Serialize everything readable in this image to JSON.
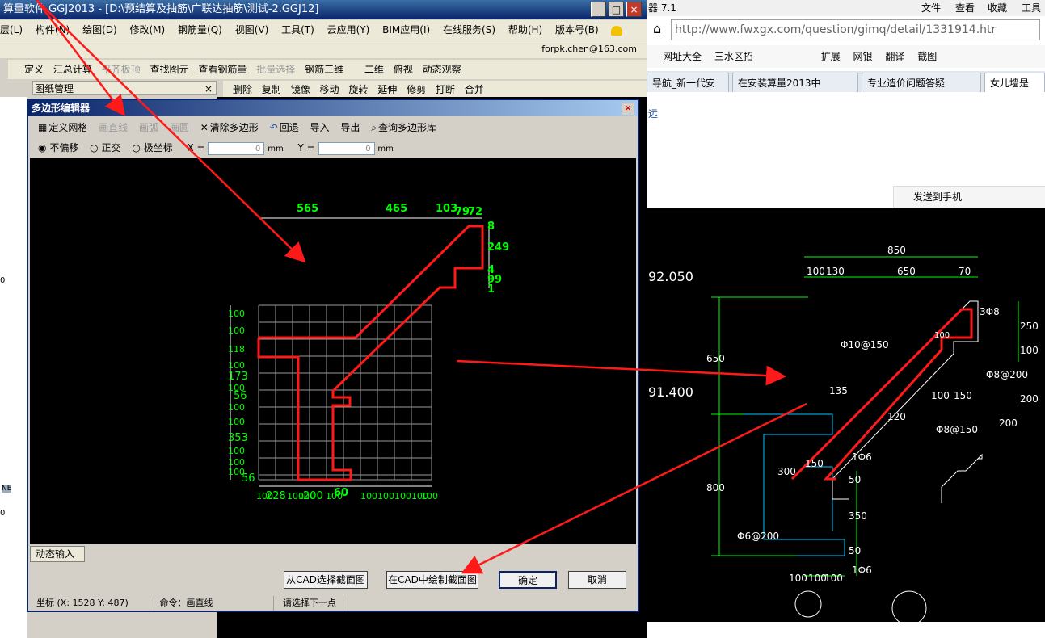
{
  "app": {
    "title": "算量软件 GGJ2013 - [D:\\预结算及抽筋\\广联达抽筋\\测试-2.GGJ12]",
    "window_buttons": [
      "_",
      "□",
      "×"
    ],
    "menu": [
      "层(L)",
      "构件(N)",
      "绘图(D)",
      "修改(M)",
      "钢筋量(Q)",
      "视图(V)",
      "工具(T)",
      "云应用(Y)",
      "BIM应用(I)",
      "在线服务(S)",
      "帮助(H)",
      "版本号(B)"
    ],
    "account": "forpk.chen@163.com",
    "toolbar1": [
      "定义",
      "汇总计算",
      "平齐板顶",
      "查找图元",
      "查看钢筋量",
      "批量选择",
      "钢筋三维",
      "二维",
      "俯视",
      "动态观察"
    ],
    "panel_title": "图纸管理",
    "toolbar2": [
      "删除",
      "复制",
      "镜像",
      "移动",
      "旋转",
      "延伸",
      "修剪",
      "打断",
      "合并"
    ],
    "left_fragments": [
      "0",
      "NE",
      "0"
    ]
  },
  "dialog": {
    "title": "多边形编辑器",
    "close": "×",
    "toolbar": {
      "define_grid": "定义网格",
      "draw_line": "画直线",
      "draw_arc": "画弧",
      "draw_circle": "画圆",
      "clear_polygon": "清除多边形",
      "undo": "回退",
      "import": "导入",
      "export": "导出",
      "query_library": "查询多边形库"
    },
    "options": {
      "no_offset": "不偏移",
      "orthogonal": "正交",
      "polar": "极坐标",
      "x_label": "X =",
      "x_value": "0",
      "y_label": "Y =",
      "y_value": "0",
      "unit": "mm"
    },
    "canvas": {
      "top_dims": [
        "565",
        "465",
        "103",
        "79",
        "72"
      ],
      "right_dims": [
        "8",
        "249",
        "4",
        "99",
        "1"
      ],
      "left_dims": [
        "100",
        "100",
        "118",
        "100",
        "173",
        "100",
        "56",
        "100",
        "100",
        "353",
        "100",
        "100",
        "100",
        "56"
      ],
      "bottom_dims": [
        "100",
        "228",
        "100",
        "100",
        "200",
        "100",
        "100",
        "100",
        "100",
        "100",
        "100"
      ],
      "bottom_highlight": "60"
    },
    "status_tab": "动态输入",
    "buttons": {
      "from_cad": "从CAD选择截面图",
      "draw_in_cad": "在CAD中绘制截面图",
      "ok": "确定",
      "cancel": "取消"
    },
    "statusbar": {
      "coords": "坐标 (X: 1528 Y: 487)",
      "command": "命令：画直线",
      "prompt": "请选择下一点"
    }
  },
  "browser": {
    "title_fragment": "器 7.1",
    "menu": [
      "文件",
      "查看",
      "收藏",
      "工具"
    ],
    "url": "http://www.fwxgx.com/question/gimq/detail/1331914.htr",
    "bookmarks": [
      "网址大全",
      "三水区招",
      "扩展",
      "网银",
      "翻译",
      "截图"
    ],
    "tabs": [
      "导航_新一代安",
      "在安装算量2013中",
      "专业造价问题答疑",
      "女儿墙是"
    ],
    "side_text": "远",
    "send_to_phone": "发送到手机",
    "cad": {
      "elev_top": "92.050",
      "elev_mid": "91.400",
      "dims_top": [
        "850",
        "100",
        "130",
        "650",
        "70"
      ],
      "labels": [
        "3Φ8",
        "250",
        "100",
        "Φ10@150",
        "100",
        "Φ8@200",
        "135",
        "100",
        "150",
        "120",
        "Φ8@150",
        "200",
        "200",
        "650",
        "300",
        "150",
        "1Φ6",
        "50",
        "350",
        "800",
        "Φ6@200",
        "50",
        "1Φ6",
        "100",
        "100",
        "100"
      ]
    }
  }
}
